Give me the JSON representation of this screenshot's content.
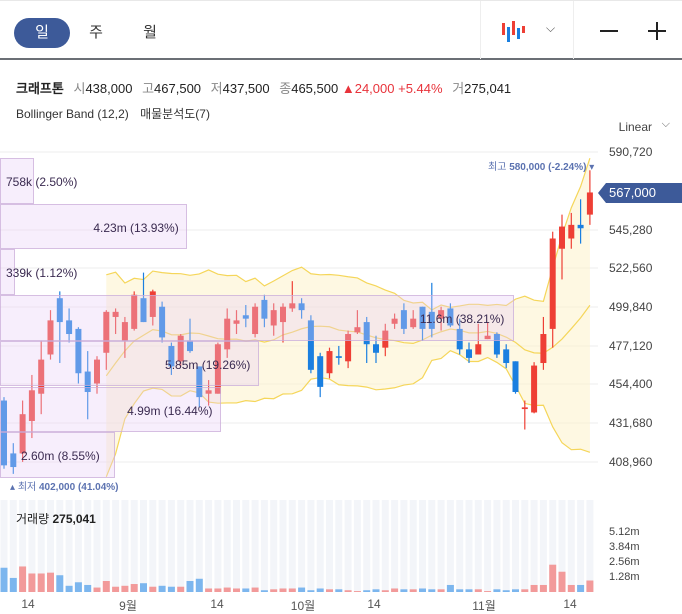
{
  "tabs": [
    {
      "label": "일",
      "selected": true
    },
    {
      "label": "주",
      "selected": false
    },
    {
      "label": "월",
      "selected": false
    }
  ],
  "toolbar": {
    "chart_type_icon": "candlestick-icon",
    "dropdown_icon": "chevron-down-icon",
    "zoom_out_icon": "minus-icon",
    "zoom_in_icon": "plus-icon"
  },
  "info": {
    "name": "크래프톤",
    "open_label": "시",
    "open": "438,000",
    "high_label": "고",
    "high": "467,500",
    "low_label": "저",
    "low": "437,500",
    "close_label": "종",
    "close": "465,500",
    "change": "▲24,000",
    "change_pct": "+5.44%",
    "vol_label": "거",
    "volume": "275,041"
  },
  "indicators": [
    "Bollinger Band (12,2)",
    "매물분석도(7)"
  ],
  "scale": "Linear",
  "price_axis": [
    "590,720",
    "545,280",
    "522,560",
    "499,840",
    "477,120",
    "454,400",
    "431,680",
    "408,960"
  ],
  "current_price": "567,000",
  "high_marker": {
    "label": "최고",
    "value": "580,000",
    "pct": "(-2.24%)"
  },
  "low_marker": {
    "label": "최저",
    "value": "402,000",
    "pct": "(41.04%)"
  },
  "volume_profile": [
    {
      "label": "758k (2.50%)",
      "pct": 2.5
    },
    {
      "label": "4.23m (13.93%)",
      "pct": 13.93
    },
    {
      "label": "339k (1.12%)",
      "pct": 1.12
    },
    {
      "label": "11.6m (38.21%)",
      "pct": 38.21
    },
    {
      "label": "5.85m (19.26%)",
      "pct": 19.26
    },
    {
      "label": "4.99m (16.44%)",
      "pct": 16.44
    },
    {
      "label": "2.60m (8.55%)",
      "pct": 8.55
    }
  ],
  "volume_pane": {
    "title": "거래량",
    "value": "275,041",
    "axis": [
      "5.12m",
      "3.84m",
      "2.56m",
      "1.28m"
    ]
  },
  "x_axis": [
    "14",
    "9월",
    "14",
    "10월",
    "14",
    "11월",
    "14"
  ],
  "colors": {
    "up": "#ee3f35",
    "down": "#1a7fe0",
    "accent": "#3d5a99",
    "band": "#f5d65a"
  },
  "chart_data": {
    "type": "candlestick",
    "ylim": [
      408960,
      590720
    ],
    "bollinger": {
      "period": 12,
      "k": 2
    },
    "ohlc": [
      [
        445000,
        447000,
        405000,
        407000
      ],
      [
        414000,
        420000,
        402000,
        406000
      ],
      [
        414000,
        445000,
        409000,
        437000
      ],
      [
        433000,
        460000,
        423000,
        451000
      ],
      [
        449000,
        480000,
        437000,
        469000
      ],
      [
        472000,
        498000,
        469000,
        492000
      ],
      [
        505000,
        509000,
        467000,
        491000
      ],
      [
        492000,
        499000,
        479000,
        484000
      ],
      [
        487000,
        488000,
        455000,
        461000
      ],
      [
        462000,
        474000,
        434000,
        450000
      ],
      [
        455000,
        471000,
        449000,
        469000
      ],
      [
        473000,
        498000,
        463000,
        497000
      ],
      [
        494000,
        499000,
        484000,
        497000
      ],
      [
        480000,
        494000,
        470000,
        491000
      ],
      [
        487000,
        509000,
        486000,
        507000
      ],
      [
        505000,
        520000,
        491000,
        491000
      ],
      [
        494000,
        510000,
        489000,
        509000
      ],
      [
        500000,
        503000,
        479000,
        482000
      ],
      [
        477000,
        479000,
        460000,
        465000
      ],
      [
        468000,
        484000,
        465000,
        483000
      ],
      [
        480000,
        493000,
        473000,
        474000
      ],
      [
        465000,
        465000,
        441000,
        447000
      ],
      [
        449000,
        457000,
        442000,
        451000
      ],
      [
        449000,
        479000,
        449000,
        478000
      ],
      [
        475000,
        499000,
        470000,
        493000
      ],
      [
        490000,
        498000,
        484000,
        492000
      ],
      [
        495000,
        501000,
        488000,
        493000
      ],
      [
        484000,
        502000,
        482000,
        500000
      ],
      [
        504000,
        507000,
        488000,
        493000
      ],
      [
        489000,
        502000,
        483000,
        498000
      ],
      [
        491000,
        502000,
        479000,
        500000
      ],
      [
        499000,
        515000,
        497000,
        502000
      ],
      [
        502000,
        505000,
        493000,
        498000
      ],
      [
        492000,
        495000,
        461000,
        463000
      ],
      [
        471000,
        473000,
        447000,
        453000
      ],
      [
        461000,
        476000,
        458000,
        474000
      ],
      [
        471000,
        477000,
        466000,
        470000
      ],
      [
        468000,
        486000,
        464000,
        484000
      ],
      [
        485000,
        498000,
        484000,
        488000
      ],
      [
        491000,
        494000,
        467000,
        478000
      ],
      [
        478000,
        483000,
        467000,
        473000
      ],
      [
        476000,
        490000,
        471000,
        486000
      ],
      [
        490000,
        496000,
        487000,
        493000
      ],
      [
        498000,
        502000,
        484000,
        487000
      ],
      [
        488000,
        498000,
        487000,
        493000
      ],
      [
        500000,
        500000,
        480000,
        487000
      ],
      [
        497000,
        514000,
        482000,
        487000
      ],
      [
        493000,
        500000,
        486000,
        498000
      ],
      [
        499000,
        502000,
        488000,
        489000
      ],
      [
        487000,
        493000,
        472000,
        475000
      ],
      [
        475000,
        479000,
        467000,
        470000
      ],
      [
        472000,
        490000,
        472000,
        478000
      ],
      [
        481000,
        491000,
        481000,
        483000
      ],
      [
        484000,
        485000,
        470000,
        472000
      ],
      [
        475000,
        478000,
        464000,
        467000
      ],
      [
        468000,
        468000,
        449000,
        450000
      ],
      [
        440000,
        445000,
        428000,
        441000
      ],
      [
        438000,
        467500,
        437500,
        465500
      ],
      [
        467000,
        494000,
        463000,
        484000
      ],
      [
        487000,
        544000,
        476000,
        540000
      ],
      [
        534000,
        554000,
        516000,
        547000
      ],
      [
        540000,
        555000,
        534000,
        548000
      ],
      [
        548000,
        563000,
        537000,
        546000
      ],
      [
        554000,
        580000,
        548000,
        567000
      ]
    ],
    "volume_m": [
      2.07,
      1.2,
      2.18,
      1.58,
      1.58,
      1.65,
      1.43,
      0.53,
      0.83,
      0.6,
      0.38,
      0.94,
      0.45,
      0.53,
      0.68,
      0.75,
      0.45,
      0.53,
      0.45,
      0.45,
      0.94,
      1.13,
      0.3,
      0.3,
      0.38,
      0.3,
      0.3,
      0.38,
      0.15,
      0.23,
      0.3,
      0.3,
      0.38,
      0.15,
      0.3,
      0.23,
      0.23,
      0.15,
      0.08,
      0.15,
      0.23,
      0.15,
      0.3,
      0.23,
      0.23,
      0.3,
      0.23,
      0.23,
      0.6,
      0.23,
      0.23,
      0.23,
      0.08,
      0.23,
      0.15,
      0.23,
      0.23,
      0.6,
      0.6,
      2.33,
      1.73,
      0.6,
      0.6,
      0.98
    ]
  }
}
